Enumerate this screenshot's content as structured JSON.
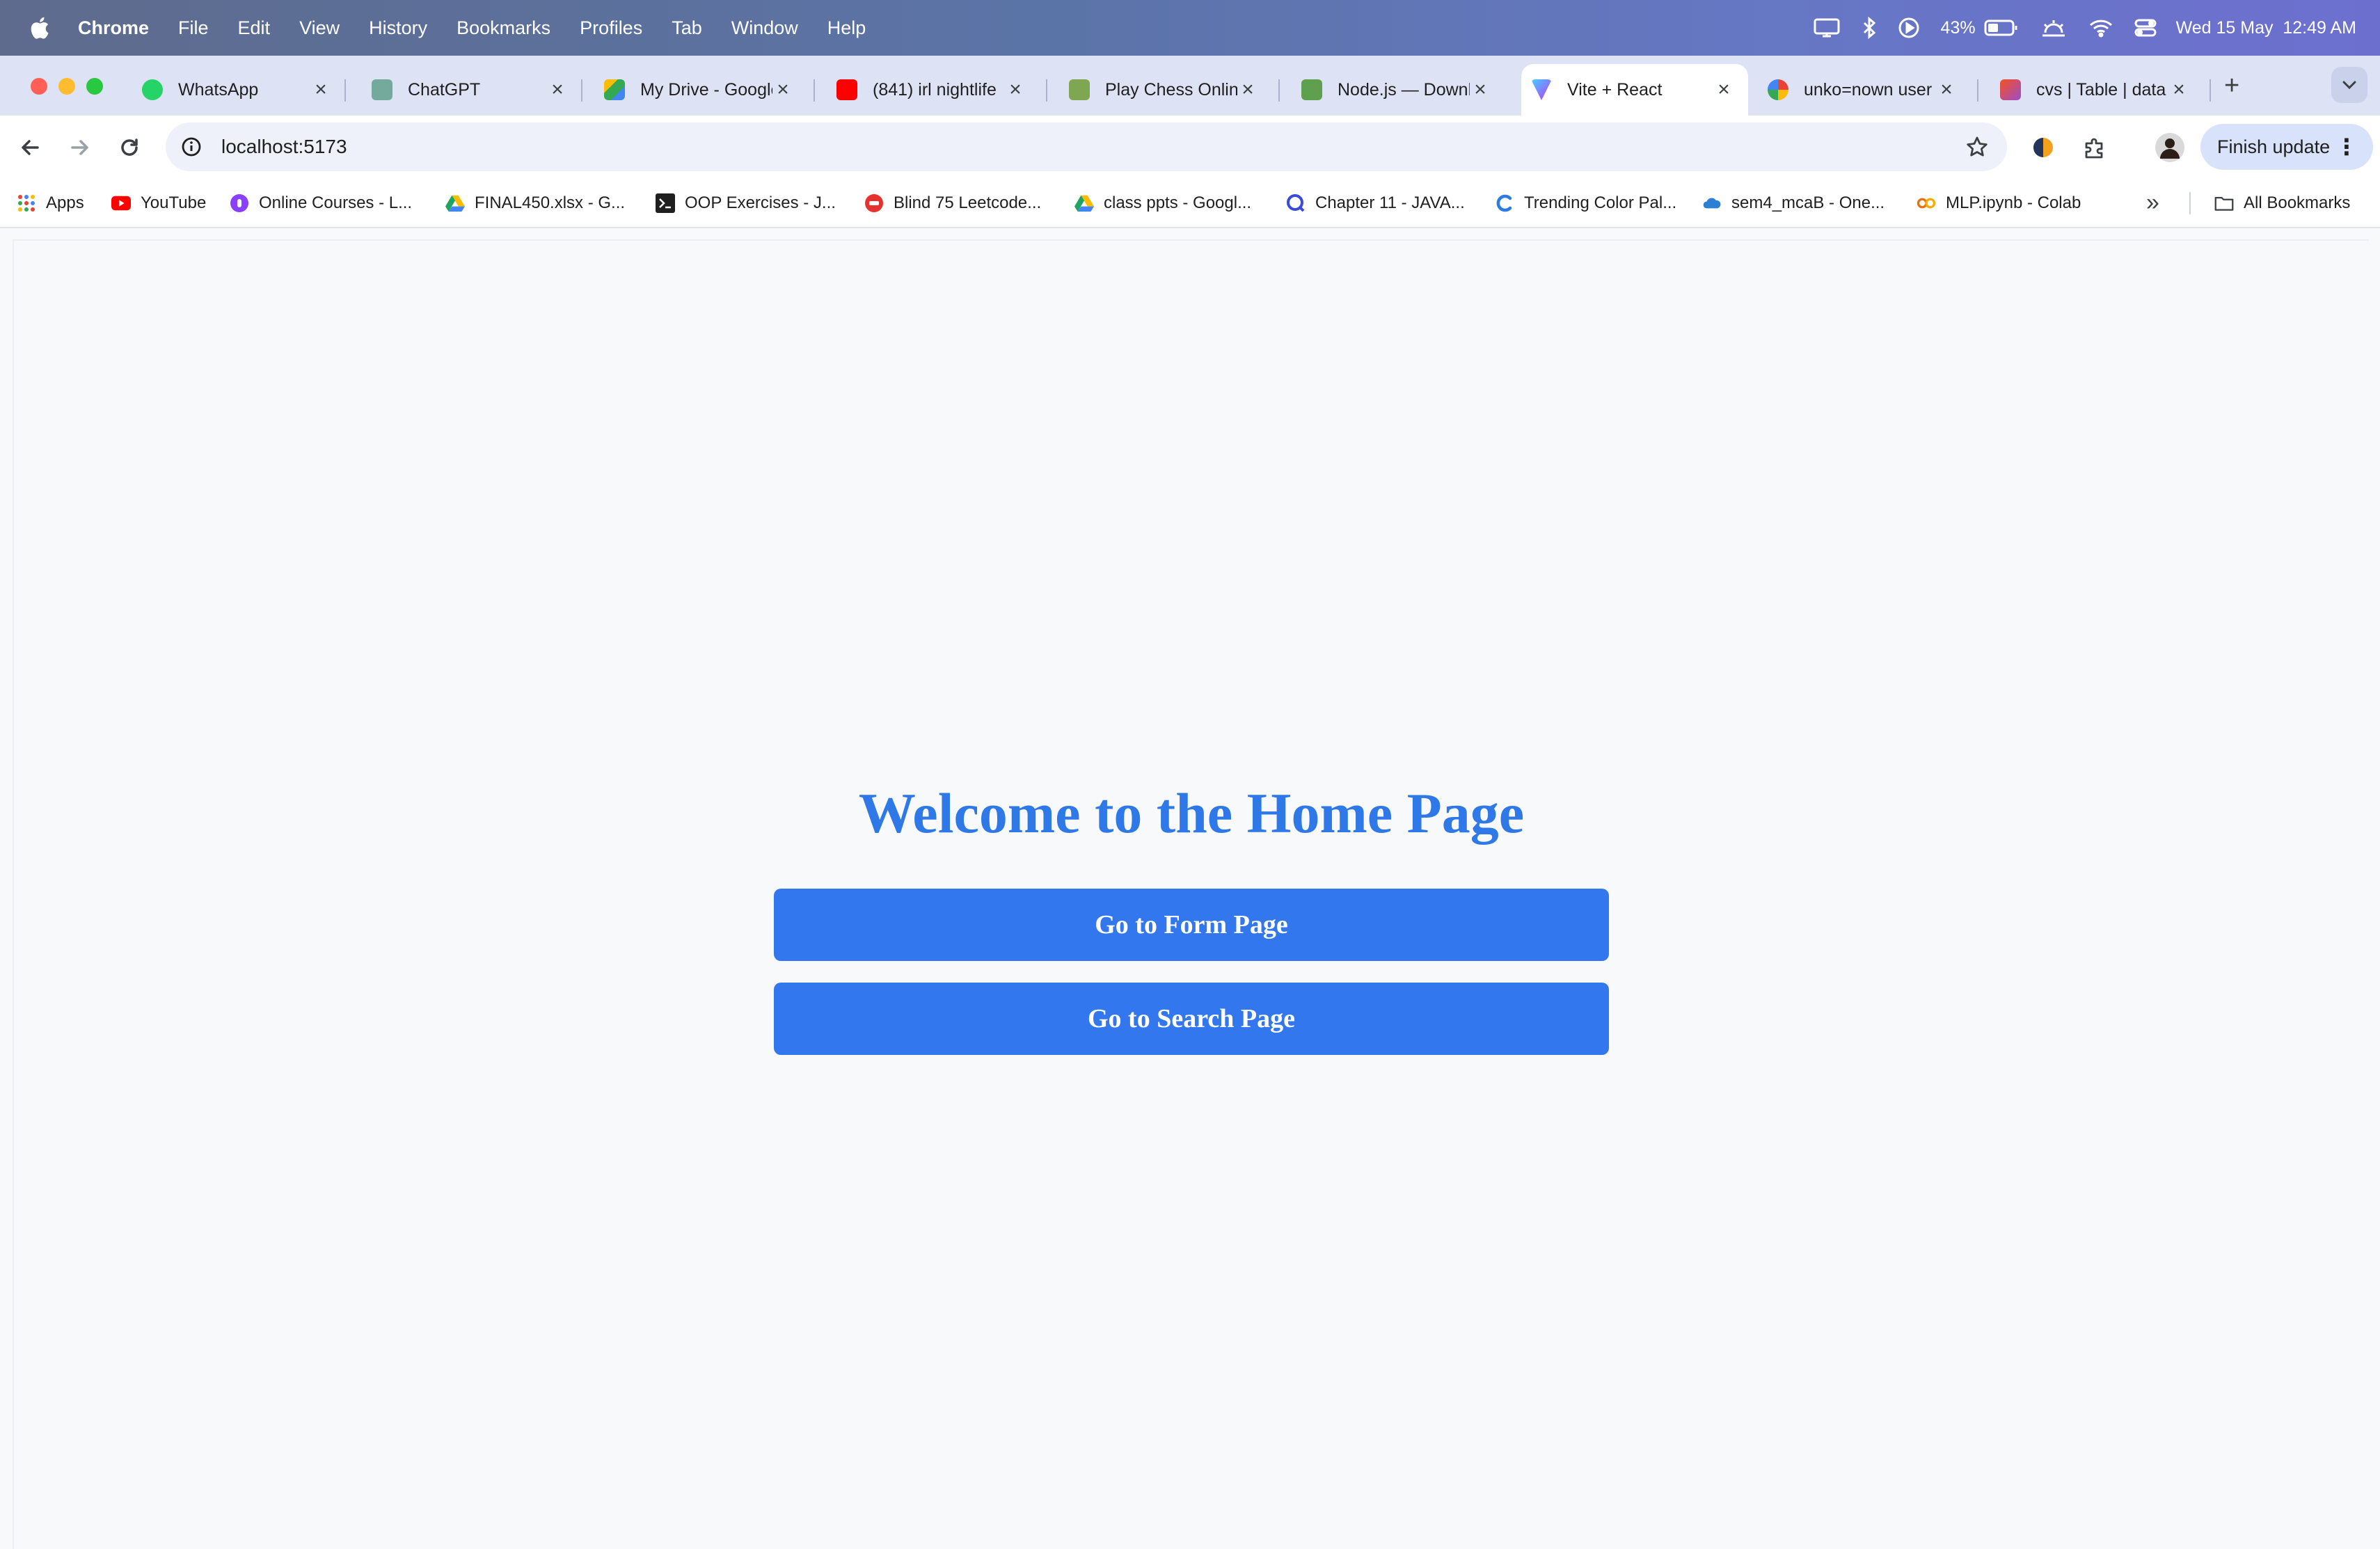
{
  "menubar": {
    "app_name": "Chrome",
    "items": [
      "File",
      "Edit",
      "View",
      "History",
      "Bookmarks",
      "Profiles",
      "Tab",
      "Window",
      "Help"
    ],
    "battery": "43%",
    "datetime": "Wed 15 May  12:49 AM"
  },
  "tabs": [
    {
      "title": "WhatsApp",
      "icon": "whatsapp-icon",
      "color": "#25d366",
      "active": false
    },
    {
      "title": "ChatGPT",
      "icon": "chatgpt-icon",
      "color": "#74aa9c",
      "active": false
    },
    {
      "title": "My Drive - Google",
      "icon": "google-drive-icon",
      "color": "#1fa463",
      "active": false
    },
    {
      "title": "(841) irl nightlife",
      "icon": "youtube-icon",
      "color": "#ff0000",
      "active": false
    },
    {
      "title": "Play Chess Online",
      "icon": "chess-icon",
      "color": "#7fa650",
      "active": false
    },
    {
      "title": "Node.js — Download",
      "icon": "nodejs-icon",
      "color": "#5fa04e",
      "active": false
    },
    {
      "title": "Vite + React",
      "icon": "vite-icon",
      "color": "#8b5cf6",
      "active": true
    },
    {
      "title": "unko=nown user",
      "icon": "google-icon",
      "color": "#4285f4",
      "active": false
    },
    {
      "title": "cvs | Table | data",
      "icon": "cvs-icon",
      "color": "#9c4dcc",
      "active": false
    }
  ],
  "toolbar": {
    "url": "localhost:5173",
    "finish_update": "Finish update"
  },
  "bookmarks": [
    {
      "label": "Apps",
      "icon": "apps-grid-icon",
      "color": "#4285f4"
    },
    {
      "label": "YouTube",
      "icon": "youtube-icon",
      "color": "#ff0000"
    },
    {
      "label": "Online Courses - L...",
      "icon": "courses-icon",
      "color": "#8a3ffc"
    },
    {
      "label": "FINAL450.xlsx - G...",
      "icon": "google-drive-icon",
      "color": "#1fa463"
    },
    {
      "label": "OOP Exercises - J...",
      "icon": "terminal-icon",
      "color": "#1f1f1f"
    },
    {
      "label": "Blind 75 Leetcode...",
      "icon": "leetcode-icon",
      "color": "#e5322d"
    },
    {
      "label": "class ppts - Googl...",
      "icon": "google-drive-icon",
      "color": "#1fa463"
    },
    {
      "label": "Chapter 11 - JAVA...",
      "icon": "search-q-icon",
      "color": "#3b4bd8"
    },
    {
      "label": "Trending Color Pal...",
      "icon": "coolors-icon",
      "color": "#2a7de1"
    },
    {
      "label": "sem4_mcaB - One...",
      "icon": "onedrive-icon",
      "color": "#2d7fd3"
    },
    {
      "label": "MLP.ipynb - Colab",
      "icon": "colab-icon",
      "color": "#f9ab00"
    }
  ],
  "all_bookmarks": "All Bookmarks",
  "page": {
    "title": "Welcome to the Home Page",
    "form_button": "Go to Form Page",
    "search_button": "Go to Search Page",
    "accent": "#3277ee"
  }
}
